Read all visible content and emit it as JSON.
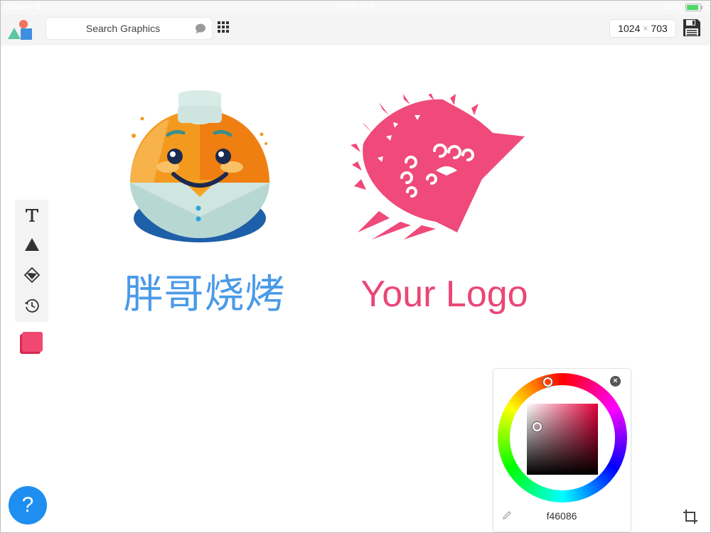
{
  "status_bar": {
    "carrier": "Carrier",
    "time": "11:01 PM",
    "battery_level": "100%"
  },
  "toolbar": {
    "search_label": "Search Graphics",
    "canvas_width": "1024",
    "size_separator": "×",
    "canvas_height": "703"
  },
  "tools": [
    {
      "name": "text-tool",
      "icon": "text-icon"
    },
    {
      "name": "shape-tool",
      "icon": "triangle-icon"
    },
    {
      "name": "fill-tool",
      "icon": "paint-bucket-icon"
    },
    {
      "name": "history-tool",
      "icon": "history-icon"
    }
  ],
  "canvas": {
    "chef_logo_text": "胖哥烧烤",
    "fan_logo_text": "Your Logo"
  },
  "color_picker": {
    "hex": "f46086"
  },
  "help": {
    "label": "?"
  },
  "colors": {
    "accent_blue": "#1e8ef0",
    "brand_pink": "#f46086",
    "chinese_text_blue": "#4a9ae8"
  }
}
